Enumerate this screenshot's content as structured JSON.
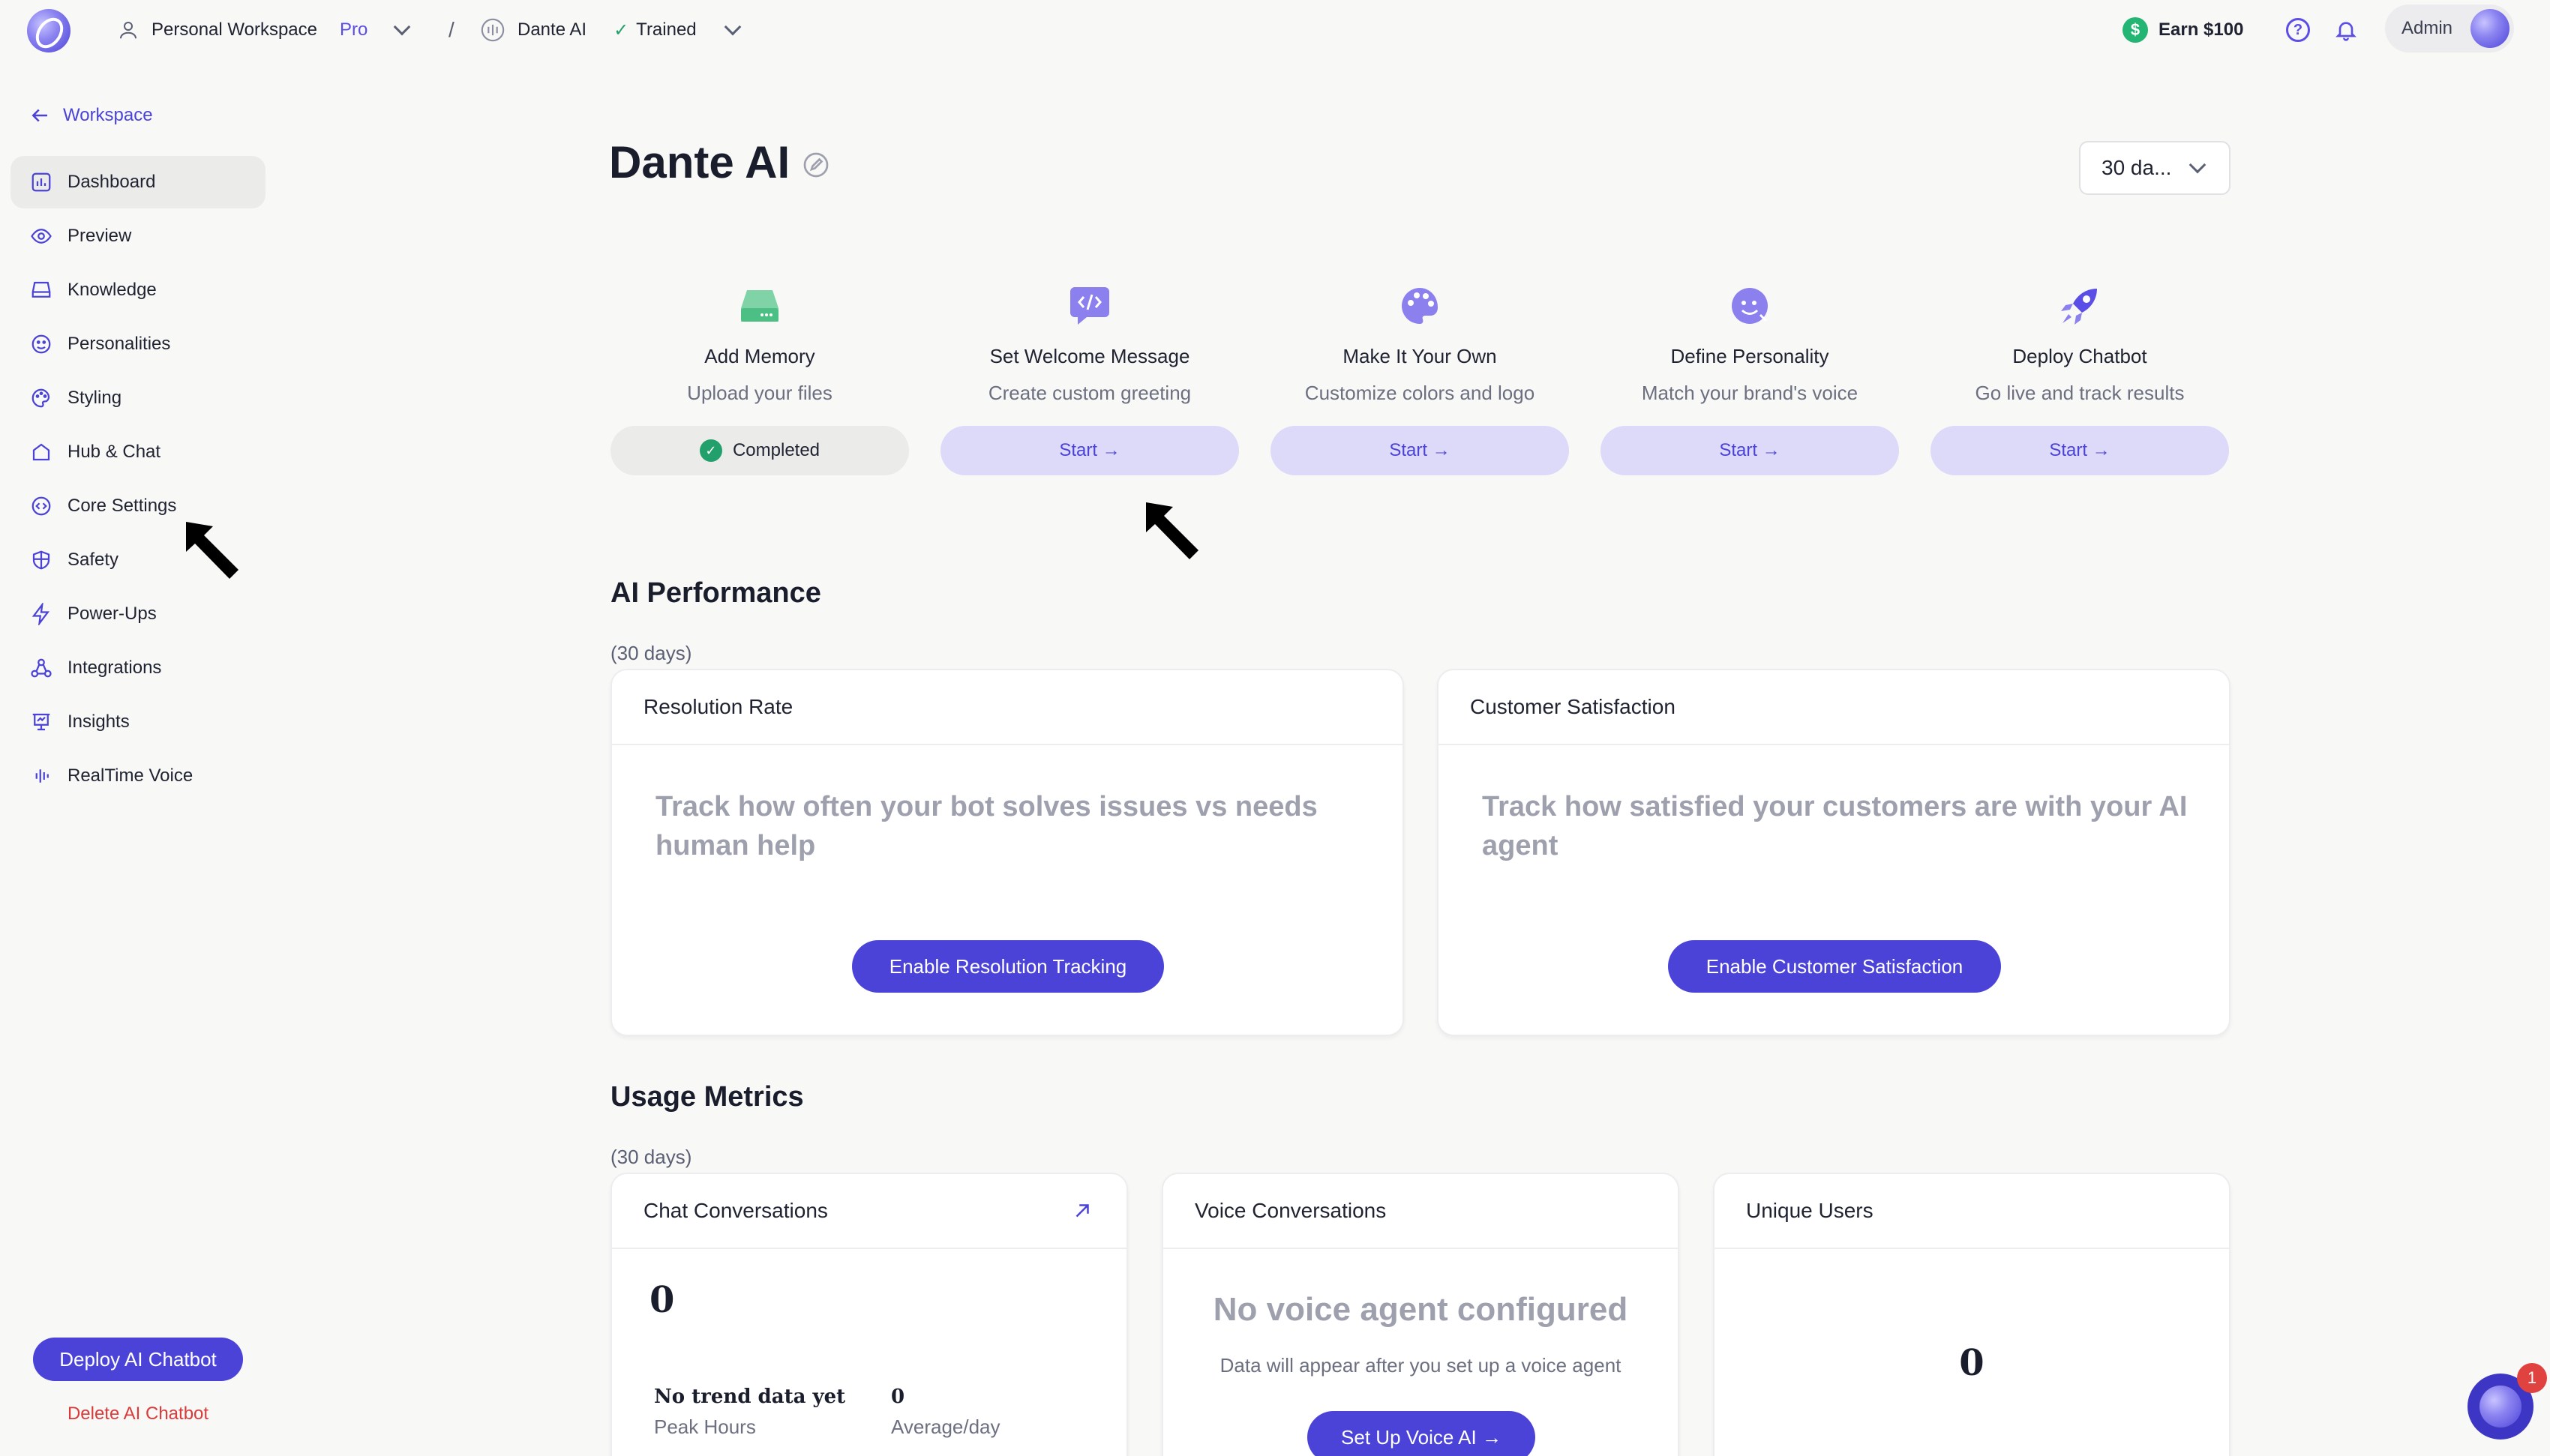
{
  "topbar": {
    "workspace_name": "Personal Workspace",
    "plan_badge": "Pro",
    "separator": "/",
    "bot_name": "Dante AI",
    "status": "Trained",
    "earn_label": "Earn $100",
    "help_icon_glyph": "?",
    "admin_label": "Admin"
  },
  "sidebar": {
    "back_label": "Workspace",
    "items": [
      {
        "label": "Dashboard",
        "icon": "dashboard-icon"
      },
      {
        "label": "Preview",
        "icon": "eye-icon"
      },
      {
        "label": "Knowledge",
        "icon": "drive-icon"
      },
      {
        "label": "Personalities",
        "icon": "face-icon"
      },
      {
        "label": "Styling",
        "icon": "palette-icon"
      },
      {
        "label": "Hub & Chat",
        "icon": "home-icon"
      },
      {
        "label": "Core Settings",
        "icon": "settings-code-icon"
      },
      {
        "label": "Safety",
        "icon": "shield-icon"
      },
      {
        "label": "Power-Ups",
        "icon": "bolt-icon"
      },
      {
        "label": "Integrations",
        "icon": "integrations-icon"
      },
      {
        "label": "Insights",
        "icon": "chart-board-icon"
      },
      {
        "label": "RealTime Voice",
        "icon": "waveform-icon"
      }
    ],
    "deploy_label": "Deploy AI Chatbot",
    "delete_label": "Delete AI Chatbot"
  },
  "main": {
    "title": "Dante AI",
    "range_value": "30 da...",
    "steps": [
      {
        "title": "Add Memory",
        "subtitle": "Upload your files",
        "button": "Completed",
        "done": true
      },
      {
        "title": "Set Welcome Message",
        "subtitle": "Create custom greeting",
        "button": "Start →",
        "done": false
      },
      {
        "title": "Make It Your Own",
        "subtitle": "Customize colors and logo",
        "button": "Start →",
        "done": false
      },
      {
        "title": "Define Personality",
        "subtitle": "Match your brand's voice",
        "button": "Start →",
        "done": false
      },
      {
        "title": "Deploy Chatbot",
        "subtitle": "Go live and track results",
        "button": "Start →",
        "done": false
      }
    ],
    "performance": {
      "title": "AI Performance",
      "period": "(30 days)",
      "resolution": {
        "title": "Resolution Rate",
        "message": "Track how often your bot solves issues vs needs human help",
        "button": "Enable Resolution Tracking"
      },
      "satisfaction": {
        "title": "Customer Satisfaction",
        "message": "Track how satisfied your customers are with your AI agent",
        "button": "Enable Customer Satisfaction"
      }
    },
    "usage": {
      "title": "Usage Metrics",
      "period": "(30 days)",
      "chat": {
        "title": "Chat Conversations",
        "value": "0",
        "trend_label": "No trend data yet",
        "peak_label": "Peak Hours",
        "avg_value": "0",
        "avg_label": "Average/day"
      },
      "voice": {
        "title": "Voice Conversations",
        "empty_title": "No voice agent configured",
        "empty_sub": "Data will appear after you set up a voice agent",
        "button": "Set Up Voice AI →"
      },
      "users": {
        "title": "Unique Users",
        "value": "0"
      }
    }
  },
  "chat_widget": {
    "badge_count": "1"
  },
  "colors": {
    "accent": "#4b43d8",
    "accent_soft": "#dcdaf8",
    "success": "#22a06b",
    "danger": "#d93a3a",
    "background": "#f8f8f7"
  }
}
